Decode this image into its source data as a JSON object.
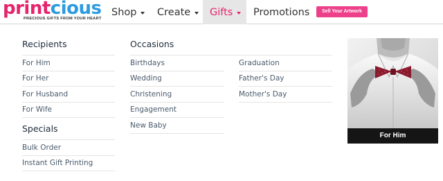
{
  "logo": {
    "part1": "print",
    "part2": "cious",
    "tagline": "PRECIOUS GIFTS FROM YOUR HEART"
  },
  "nav": {
    "shop": "Shop",
    "create": "Create",
    "gifts": "Gifts",
    "promotions": "Promotions"
  },
  "sell_button": "Sell Your Artwork",
  "recipients": {
    "title": "Recipients",
    "items": [
      "For Him",
      "For Her",
      "For Husband",
      "For Wife"
    ]
  },
  "specials": {
    "title": "Specials",
    "items": [
      "Bulk Order",
      "Instant Gift Printing"
    ]
  },
  "occasions": {
    "title": "Occasions",
    "col1": [
      "Birthdays",
      "Wedding",
      "Christening",
      "Engagement",
      "New Baby"
    ],
    "col2": [
      "Graduation",
      "Father's Day",
      "Mother's Day"
    ]
  },
  "promo": {
    "caption": "For Him"
  },
  "colors": {
    "brand_pink": "#e6246b",
    "brand_blue": "#2c9be0",
    "button_pink": "#ee3f8b"
  }
}
